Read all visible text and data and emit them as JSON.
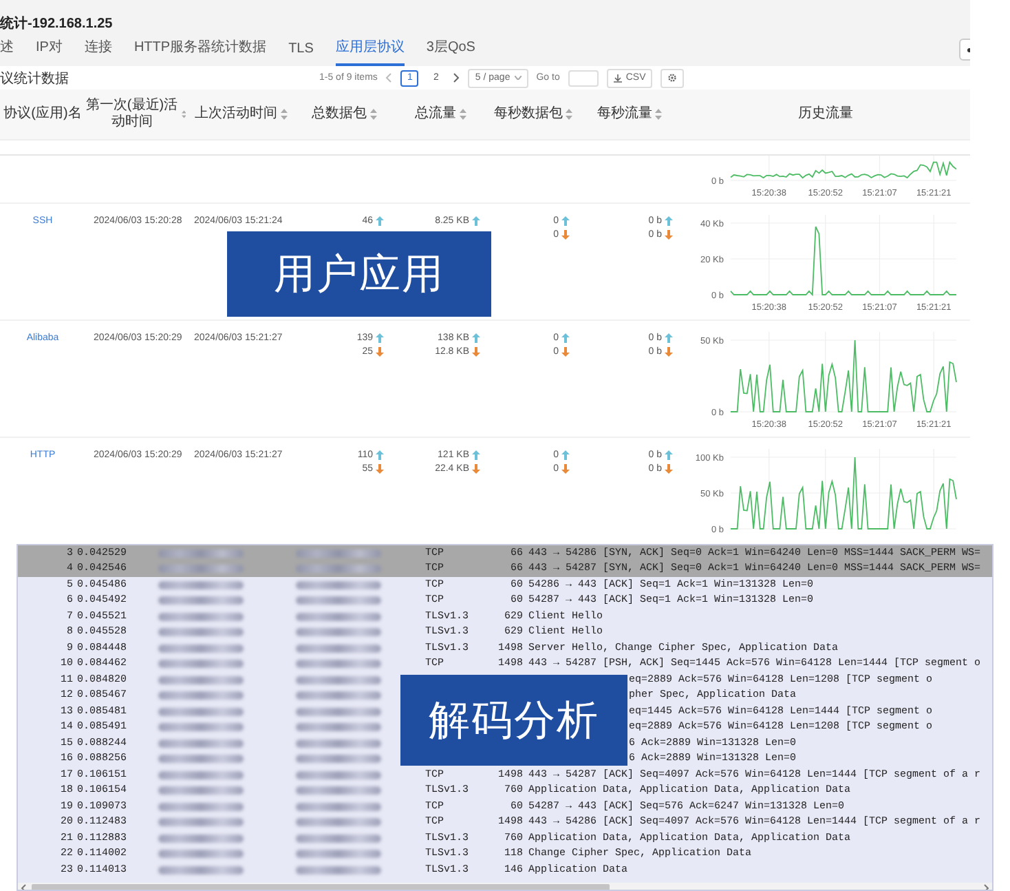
{
  "window": {
    "title": "统计-192.168.1.25"
  },
  "tabs": [
    {
      "label": "述",
      "selected": false
    },
    {
      "label": "IP对",
      "selected": false
    },
    {
      "label": "连接",
      "selected": false
    },
    {
      "label": "HTTP服务器统计数据",
      "selected": false
    },
    {
      "label": "TLS",
      "selected": false
    },
    {
      "label": "应用层协议",
      "selected": true
    },
    {
      "label": "3层QoS",
      "selected": false
    }
  ],
  "section_title": "议统计数据",
  "pagination": {
    "summary": "1-5 of 9 items",
    "pages": [
      {
        "label": "1",
        "selected": true
      },
      {
        "label": "2",
        "selected": false
      }
    ],
    "page_size": "5 / page",
    "goto_label": "Go to",
    "export_label": "CSV"
  },
  "table": {
    "overlay_label": "用户应用",
    "columns": [
      {
        "label": "协议(应用)名",
        "sortable": false
      },
      {
        "label": "第一次(最近)活动时间",
        "sortable": true
      },
      {
        "label": "上次活动时间",
        "sortable": true
      },
      {
        "label": "总数据包",
        "sortable": true
      },
      {
        "label": "总流量",
        "sortable": true
      },
      {
        "label": "每秒数据包",
        "sortable": true
      },
      {
        "label": "每秒流量",
        "sortable": true
      },
      {
        "label": "历史流量",
        "sortable": false
      }
    ],
    "rows": [
      {
        "chart": {
          "kind": "wiggle",
          "y_ticks": [
            "0 b"
          ],
          "x_ticks": [
            "15:20:38",
            "15:20:52",
            "15:21:07",
            "15:21:21"
          ]
        }
      },
      {
        "name": "SSH",
        "first_active": "2024/06/03 15:20:28",
        "last_active": "2024/06/03 15:21:24",
        "total_packets": {
          "up": "46"
        },
        "total_traffic": {
          "up": "8.25 KB"
        },
        "packets_per_sec": {
          "up": "0",
          "down": "0"
        },
        "traffic_per_sec": {
          "up": "0 b",
          "down": "0 b"
        },
        "chart": {
          "kind": "spike",
          "y_ticks": [
            "40 Kb",
            "20 Kb",
            "0 b"
          ],
          "x_ticks": [
            "15:20:38",
            "15:20:52",
            "15:21:07",
            "15:21:21"
          ]
        }
      },
      {
        "name": "Alibaba",
        "first_active": "2024/06/03 15:20:29",
        "last_active": "2024/06/03 15:21:27",
        "total_packets": {
          "up": "139",
          "down": "25"
        },
        "total_traffic": {
          "up": "138 KB",
          "down": "12.8 KB"
        },
        "packets_per_sec": {
          "up": "0",
          "down": "0"
        },
        "traffic_per_sec": {
          "up": "0 b",
          "down": "0 b"
        },
        "chart": {
          "kind": "burst",
          "y_ticks": [
            "50 Kb",
            "0 b"
          ],
          "x_ticks": [
            "15:20:38",
            "15:20:52",
            "15:21:07",
            "15:21:21"
          ]
        }
      },
      {
        "name": "HTTP",
        "first_active": "2024/06/03 15:20:29",
        "last_active": "2024/06/03 15:21:27",
        "total_packets": {
          "up": "110",
          "down": "55"
        },
        "total_traffic": {
          "up": "121 KB",
          "down": "22.4 KB"
        },
        "packets_per_sec": {
          "up": "0",
          "down": "0"
        },
        "traffic_per_sec": {
          "up": "0 b",
          "down": "0 b"
        },
        "chart": {
          "kind": "burst",
          "y_ticks": [
            "100 Kb",
            "50 Kb",
            "0 b"
          ]
        }
      }
    ]
  },
  "packets": {
    "overlay_label": "解码分析",
    "rows": [
      {
        "no": "3",
        "time": "0.042529",
        "protocol": "TCP",
        "length": "66",
        "info": "443 → 54286 [SYN, ACK] Seq=0 Ack=1 Win=64240 Len=0 MSS=1444 SACK_PERM WS=",
        "selected": true,
        "covered": false
      },
      {
        "no": "4",
        "time": "0.042546",
        "protocol": "TCP",
        "length": "66",
        "info": "443 → 54287 [SYN, ACK] Seq=0 Ack=1 Win=64240 Len=0 MSS=1444 SACK_PERM WS=",
        "selected": true,
        "covered": false
      },
      {
        "no": "5",
        "time": "0.045486",
        "protocol": "TCP",
        "length": "60",
        "info": "54286 → 443 [ACK] Seq=1 Ack=1 Win=131328 Len=0",
        "selected": false,
        "covered": false
      },
      {
        "no": "6",
        "time": "0.045492",
        "protocol": "TCP",
        "length": "60",
        "info": "54287 → 443 [ACK] Seq=1 Ack=1 Win=131328 Len=0",
        "selected": false,
        "covered": false
      },
      {
        "no": "7",
        "time": "0.045521",
        "protocol": "TLSv1.3",
        "length": "629",
        "info": "Client Hello",
        "selected": false,
        "covered": false
      },
      {
        "no": "8",
        "time": "0.045528",
        "protocol": "TLSv1.3",
        "length": "629",
        "info": "Client Hello",
        "selected": false,
        "covered": false
      },
      {
        "no": "9",
        "time": "0.084448",
        "protocol": "TLSv1.3",
        "length": "1498",
        "info": "Server Hello, Change Cipher Spec, Application Data",
        "selected": false,
        "covered": false
      },
      {
        "no": "10",
        "time": "0.084462",
        "protocol": "TCP",
        "length": "1498",
        "info": "443 → 54287 [PSH, ACK] Seq=1445 Ack=576 Win=64128 Len=1444 [TCP segment o",
        "selected": false,
        "covered": false
      },
      {
        "no": "11",
        "time": "0.084820",
        "info": "eq=2889 Ack=576 Win=64128 Len=1208 [TCP segment o",
        "selected": false,
        "covered": true
      },
      {
        "no": "12",
        "time": "0.085467",
        "info": "pher Spec, Application Data",
        "selected": false,
        "covered": true
      },
      {
        "no": "13",
        "time": "0.085481",
        "info": "eq=1445 Ack=576 Win=64128 Len=1444 [TCP segment o",
        "selected": false,
        "covered": true
      },
      {
        "no": "14",
        "time": "0.085491",
        "info": "eq=2889 Ack=576 Win=64128 Len=1208 [TCP segment o",
        "selected": false,
        "covered": true
      },
      {
        "no": "15",
        "time": "0.088244",
        "info": "6 Ack=2889 Win=131328 Len=0",
        "selected": false,
        "covered": true
      },
      {
        "no": "16",
        "time": "0.088256",
        "info": "6 Ack=2889 Win=131328 Len=0",
        "selected": false,
        "covered": true
      },
      {
        "no": "17",
        "time": "0.106151",
        "protocol": "TCP",
        "length": "1498",
        "info": "443 → 54287 [ACK] Seq=4097 Ack=576 Win=64128 Len=1444 [TCP segment of a r",
        "selected": false,
        "covered": false
      },
      {
        "no": "18",
        "time": "0.106154",
        "protocol": "TLSv1.3",
        "length": "760",
        "info": "Application Data, Application Data, Application Data",
        "selected": false,
        "covered": false
      },
      {
        "no": "19",
        "time": "0.109073",
        "protocol": "TCP",
        "length": "60",
        "info": "54287 → 443 [ACK] Seq=576 Ack=6247 Win=131328 Len=0",
        "selected": false,
        "covered": false
      },
      {
        "no": "20",
        "time": "0.112483",
        "protocol": "TCP",
        "length": "1498",
        "info": "443 → 54286 [ACK] Seq=4097 Ack=576 Win=64128 Len=1444 [TCP segment of a r",
        "selected": false,
        "covered": false
      },
      {
        "no": "21",
        "time": "0.112883",
        "protocol": "TLSv1.3",
        "length": "760",
        "info": "Application Data, Application Data, Application Data",
        "selected": false,
        "covered": false
      },
      {
        "no": "22",
        "time": "0.114002",
        "protocol": "TLSv1.3",
        "length": "118",
        "info": "Change Cipher Spec, Application Data",
        "selected": false,
        "covered": false
      },
      {
        "no": "23",
        "time": "0.114013",
        "protocol": "TLSv1.3",
        "length": "146",
        "info": "Application Data",
        "selected": false,
        "covered": false
      }
    ]
  }
}
